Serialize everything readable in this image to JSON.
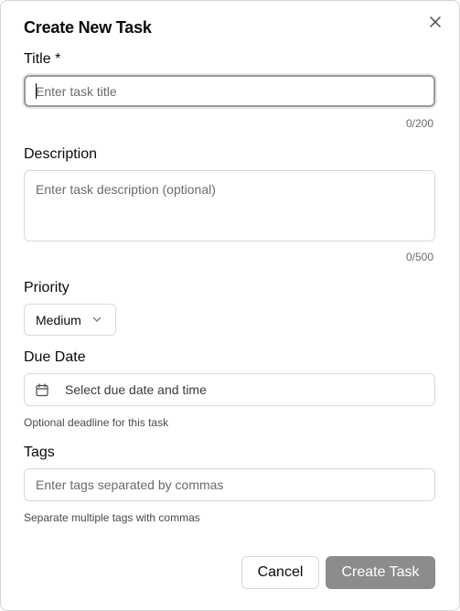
{
  "dialog": {
    "title": "Create New Task"
  },
  "title_field": {
    "label": "Title *",
    "placeholder": "Enter task title",
    "value": "",
    "counter": "0/200"
  },
  "description_field": {
    "label": "Description",
    "placeholder": "Enter task description (optional)",
    "value": "",
    "counter": "0/500"
  },
  "priority_field": {
    "label": "Priority",
    "selected": "Medium"
  },
  "due_date_field": {
    "label": "Due Date",
    "placeholder": "Select due date and time",
    "hint": "Optional deadline for this task"
  },
  "tags_field": {
    "label": "Tags",
    "placeholder": "Enter tags separated by commas",
    "value": "",
    "hint": "Separate multiple tags with commas"
  },
  "actions": {
    "cancel_label": "Cancel",
    "create_label": "Create Task"
  },
  "icons": {
    "close": "close-icon",
    "chevron": "chevron-down-icon",
    "calendar": "calendar-icon"
  },
  "colors": {
    "primary_disabled": "#8c8c8c",
    "border": "#d9d9d9",
    "muted_text": "#6b6b6b"
  }
}
